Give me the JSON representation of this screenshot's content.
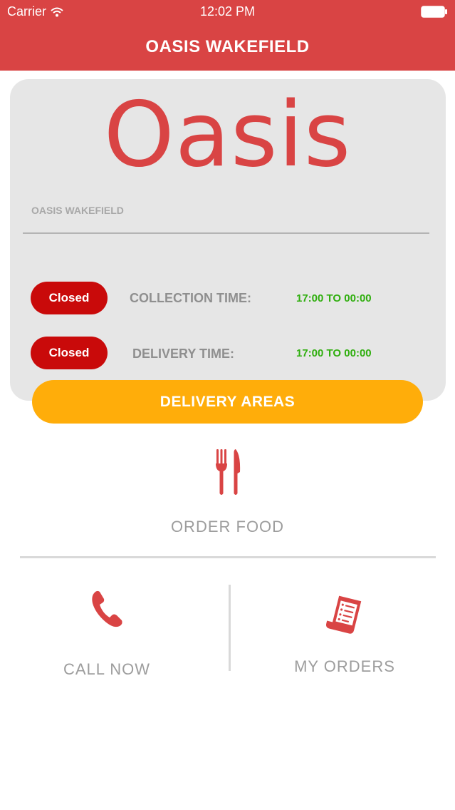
{
  "status_bar": {
    "carrier": "Carrier",
    "time": "12:02 PM",
    "icons": [
      "wifi-icon",
      "battery-icon"
    ]
  },
  "header": {
    "title": "OASIS WAKEFIELD",
    "color": "#d94444"
  },
  "store_card": {
    "logo_text": "Oasis",
    "store_name": "OASIS WAKEFIELD",
    "collection": {
      "status": "Closed",
      "label": "COLLECTION TIME:",
      "hours": "17:00 TO 00:00"
    },
    "delivery": {
      "status": "Closed",
      "label": "DELIVERY TIME:",
      "hours": "17:00 TO 00:00"
    }
  },
  "delivery_areas_button": "DELIVERY AREAS",
  "menu": {
    "order_food": {
      "label": "ORDER FOOD",
      "icon": "fork-knife-icon"
    },
    "call_now": {
      "label": "CALL NOW",
      "icon": "phone-icon"
    },
    "my_orders": {
      "label": "MY ORDERS",
      "icon": "receipt-icon"
    }
  },
  "colors": {
    "accent_red": "#d94444",
    "closed_red": "#c90a0a",
    "open_hours_green": "#2fae0e",
    "delivery_button_orange": "#ffad0a"
  }
}
